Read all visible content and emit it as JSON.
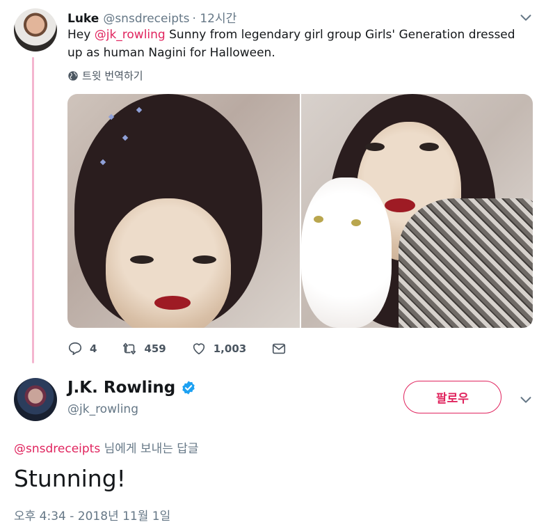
{
  "original_tweet": {
    "author_name": "Luke",
    "author_handle": "@snsdreceipts",
    "time_ago": "· 12시간",
    "text_prefix": "Hey ",
    "mention": "@jk_rowling",
    "text_body": " Sunny from legendary girl group Girls' Generation dressed up as human Nagini for Halloween.",
    "translate_label": "트윗 번역하기",
    "actions": {
      "reply_count": "4",
      "retweet_count": "459",
      "like_count": "1,003"
    },
    "icons": [
      "chevron-down-icon",
      "globe-icon",
      "reply-icon",
      "retweet-icon",
      "like-icon",
      "message-icon"
    ]
  },
  "reply_tweet": {
    "author_name": "J.K. Rowling",
    "author_handle": "@jk_rowling",
    "follow_label": "팔로우",
    "reply_to_handle": "@snsdreceipts",
    "reply_to_suffix": " 님에게 보내는 답글",
    "text": "Stunning!",
    "timestamp": "오후 4:34 - 2018년 11월 1일",
    "icons": [
      "verified-badge-icon",
      "chevron-down-icon"
    ]
  },
  "colors": {
    "accent": "#e0245e",
    "thread_line": "#f4b5cf",
    "verified": "#1da1f2",
    "secondary_text": "#657786"
  }
}
